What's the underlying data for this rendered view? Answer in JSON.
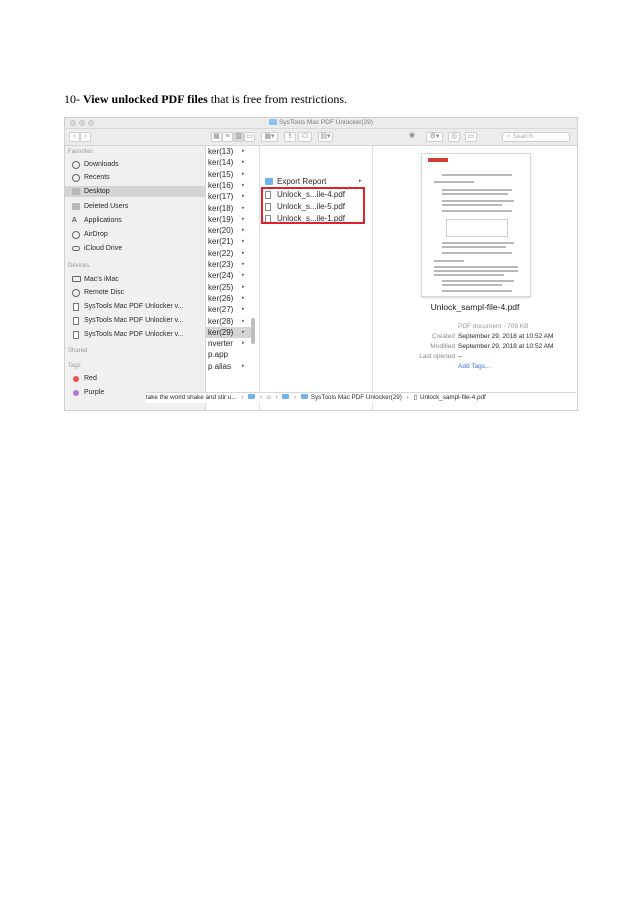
{
  "step": {
    "number": "10- ",
    "bold": "View unlocked PDF files",
    "rest": " that is free from restrictions."
  },
  "window": {
    "title": "SysTools Mac PDF Unlocker(29)"
  },
  "toolbar": {
    "back_icon": "‹",
    "forward_icon": "›",
    "search_placeholder": "Search"
  },
  "sidebar": {
    "favorites_header": "Favorites",
    "favorites": [
      {
        "label": "Downloads",
        "icon": "download-icon"
      },
      {
        "label": "Recents",
        "icon": "clock-icon"
      },
      {
        "label": "Desktop",
        "icon": "folder-icon",
        "selected": true
      },
      {
        "label": "Deleted Users",
        "icon": "folder-icon"
      },
      {
        "label": "Applications",
        "icon": "applications-icon"
      },
      {
        "label": "AirDrop",
        "icon": "airdrop-icon"
      },
      {
        "label": "iCloud Drive",
        "icon": "cloud-icon"
      }
    ],
    "devices_header": "Devices",
    "devices": [
      {
        "label": "Mac's iMac",
        "icon": "monitor-icon"
      },
      {
        "label": "Remote Disc",
        "icon": "disc-icon"
      },
      {
        "label": "SysTools Mac PDF Unlocker v...",
        "icon": "disk-icon"
      },
      {
        "label": "SysTools Mac PDF Unlocker v...",
        "icon": "disk-icon"
      },
      {
        "label": "SysTools Mac PDF Unlocker v...",
        "icon": "disk-icon"
      }
    ],
    "shared_header": "Shared",
    "tags_header": "Tags",
    "tags": [
      {
        "label": "Red",
        "color": "#e5534b"
      },
      {
        "label": "Purple",
        "color": "#b57ad6"
      }
    ]
  },
  "column1": {
    "items": [
      {
        "label": "ker(13)",
        "arrow": "▸"
      },
      {
        "label": "ker(14)",
        "arrow": "▸"
      },
      {
        "label": "ker(15)",
        "arrow": "▸"
      },
      {
        "label": "ker(16)",
        "arrow": "▸"
      },
      {
        "label": "ker(17)",
        "arrow": "▸"
      },
      {
        "label": "ker(18)",
        "arrow": "▸"
      },
      {
        "label": "ker(19)",
        "arrow": "▸"
      },
      {
        "label": "ker(20)",
        "arrow": "▸"
      },
      {
        "label": "ker(21)",
        "arrow": "▸"
      },
      {
        "label": "ker(22)",
        "arrow": "▸"
      },
      {
        "label": "ker(23)",
        "arrow": "▸"
      },
      {
        "label": "ker(24)",
        "arrow": "▸"
      },
      {
        "label": "ker(25)",
        "arrow": "▸"
      },
      {
        "label": "ker(26)",
        "arrow": "▸"
      },
      {
        "label": "ker(27)",
        "arrow": "▸"
      },
      {
        "label": "ker(28)",
        "arrow": "▸"
      },
      {
        "label": "ker(29)",
        "arrow": "▸",
        "selected": true
      },
      {
        "label": "nverter",
        "arrow": "▸"
      },
      {
        "label": "p.app",
        "arrow": ""
      },
      {
        "label": "p alias",
        "arrow": "▸"
      }
    ]
  },
  "column2": {
    "items": [
      {
        "label": "Export Report",
        "type": "folder",
        "arrow": "▸"
      },
      {
        "label": "Unlock_s...ile-4.pdf",
        "type": "pdf",
        "arrow": ""
      },
      {
        "label": "Unlock_s...ile-5.pdf",
        "type": "pdf",
        "arrow": ""
      },
      {
        "label": "Unlock_s...ile-1.pdf",
        "type": "pdf",
        "arrow": ""
      }
    ]
  },
  "preview": {
    "file_name": "Unlock_sampl-file-4.pdf",
    "kind": "PDF document - 709 KB",
    "created_label": "Created",
    "created_value": "September 29, 2018 at 10:52 AM",
    "modified_label": "Modified",
    "modified_value": "September 29, 2018 at 10:52 AM",
    "last_opened_label": "Last opened",
    "last_opened_value": "--",
    "add_tags": "Add Tags..."
  },
  "pathbar": {
    "segments": [
      "take the world shake and stir u...",
      "SysTools Mac PDF Unlocker(29)",
      "Unlock_sampl-file-4.pdf"
    ],
    "separator": "›"
  },
  "colors": {
    "highlight_box": "#e0202a",
    "folder": "#72b3ea",
    "link": "#3a74d8"
  }
}
